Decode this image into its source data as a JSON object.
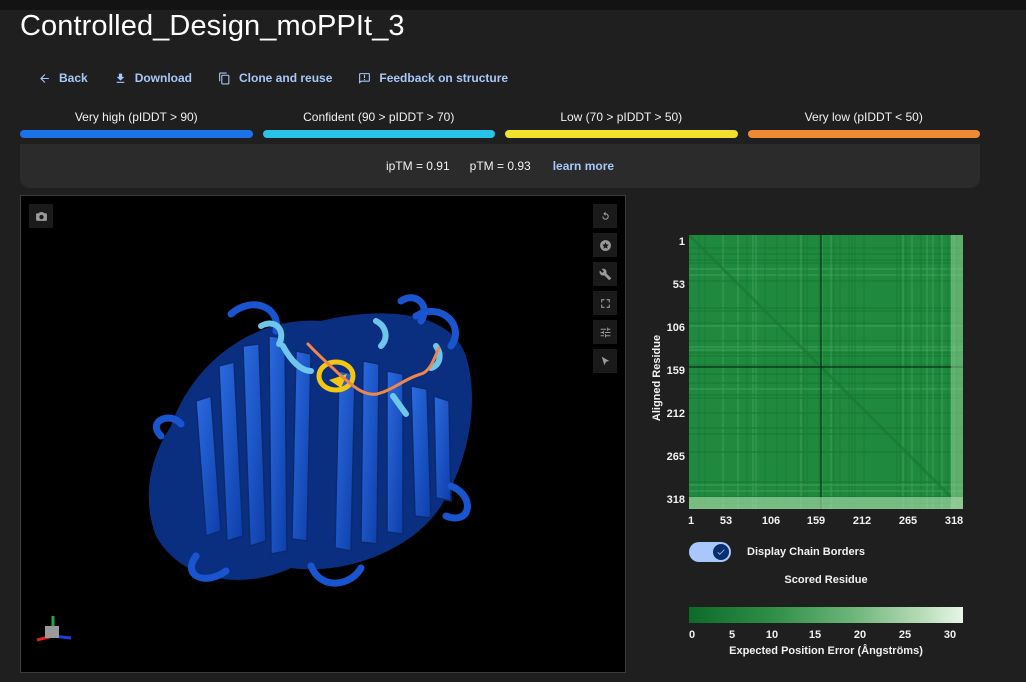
{
  "page": {
    "title": "Controlled_Design_moPPIt_3"
  },
  "actions": [
    {
      "label": "Back",
      "icon": "arrow-left-icon"
    },
    {
      "label": "Download",
      "icon": "download-icon"
    },
    {
      "label": "Clone and reuse",
      "icon": "copy-icon"
    },
    {
      "label": "Feedback on structure",
      "icon": "feedback-icon"
    }
  ],
  "confidence_legend": [
    {
      "label": "Very high (pIDDT > 90)",
      "color": "#1a73e8"
    },
    {
      "label": "Confident (90 > pIDDT > 70)",
      "color": "#27c4e8"
    },
    {
      "label": "Low (70 > pIDDT > 50)",
      "color": "#f2e12a"
    },
    {
      "label": "Very low (pIDDT < 50)",
      "color": "#f08933"
    }
  ],
  "scores": {
    "iptm": "ipTM = 0.91",
    "ptm": "pTM = 0.93",
    "learn_more": "learn more"
  },
  "viewer": {
    "tools": [
      "reset-view-icon",
      "spin-icon",
      "measure-icon",
      "fullscreen-icon",
      "settings-icon",
      "select-cursor-icon"
    ],
    "structure_colors": {
      "very_high": "#1a55d0",
      "confident": "#6ec6ea",
      "low": "#f2c811",
      "very_low": "#f0874a"
    }
  },
  "pae": {
    "y_label": "Aligned Residue",
    "x_label": "Scored Residue",
    "ticks": [
      "1",
      "53",
      "106",
      "159",
      "212",
      "265",
      "318"
    ],
    "toggle_label": "Display Chain Borders",
    "toggle_on": true,
    "colorbar_ticks": [
      "0",
      "5",
      "10",
      "15",
      "20",
      "25",
      "30"
    ],
    "colorbar_title": "Expected Position Error (Ångströms)"
  },
  "chart_data": {
    "type": "heatmap",
    "title": "",
    "xlabel": "Scored Residue",
    "ylabel": "Aligned Residue",
    "x_ticks": [
      1,
      53,
      106,
      159,
      212,
      265,
      318
    ],
    "y_ticks": [
      1,
      53,
      106,
      159,
      212,
      265,
      318
    ],
    "residue_range": [
      1,
      318
    ],
    "chain_border_residue": 159,
    "colorbar": {
      "range": [
        0,
        30
      ],
      "ticks": [
        0,
        5,
        10,
        15,
        20,
        25,
        30
      ],
      "label": "Expected Position Error (Ångströms)",
      "low_color": "#0d6b2a",
      "high_color": "#e9f5e8"
    }
  }
}
